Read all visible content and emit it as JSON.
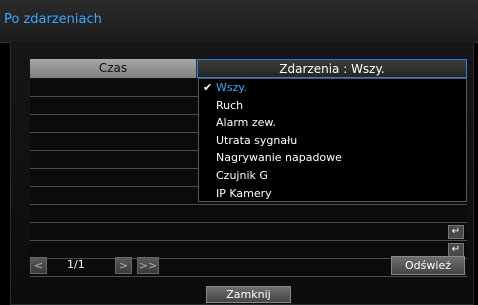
{
  "window": {
    "title": "Po zdarzeniach"
  },
  "table": {
    "col_time": "Czas",
    "col_events": "Zdarzenia : Wszy.",
    "rows": [
      {
        "enter_icon": "enter-icon"
      },
      {
        "enter_icon": "enter-icon"
      },
      {
        "enter_icon": "enter-icon"
      },
      {
        "enter_icon": "enter-icon"
      },
      {
        "enter_icon": "enter-icon"
      },
      {
        "enter_icon": "enter-icon"
      },
      {
        "enter_icon": "enter-icon"
      },
      {
        "enter_icon": "enter-icon"
      },
      {
        "enter_icon": "enter-icon"
      },
      {
        "enter_icon": "enter-icon"
      },
      {
        "enter_icon": "enter-icon"
      },
      {
        "enter_icon": "enter-icon"
      }
    ]
  },
  "dropdown": {
    "options": [
      {
        "label": "Wszy.",
        "selected": true
      },
      {
        "label": "Ruch",
        "selected": false
      },
      {
        "label": "Alarm zew.",
        "selected": false
      },
      {
        "label": "Utrata sygnału",
        "selected": false
      },
      {
        "label": "Nagrywanie napadowe",
        "selected": false
      },
      {
        "label": "Czujnik G",
        "selected": false
      },
      {
        "label": "IP Kamery",
        "selected": false
      }
    ]
  },
  "pagination": {
    "page": "1/1"
  },
  "buttons": {
    "refresh": "Odśwież",
    "close": "Zamknij"
  },
  "colors": {
    "accent": "#3ba8ff",
    "header_grey": "#a8a8a8",
    "focus_border": "#2a7fd8"
  }
}
